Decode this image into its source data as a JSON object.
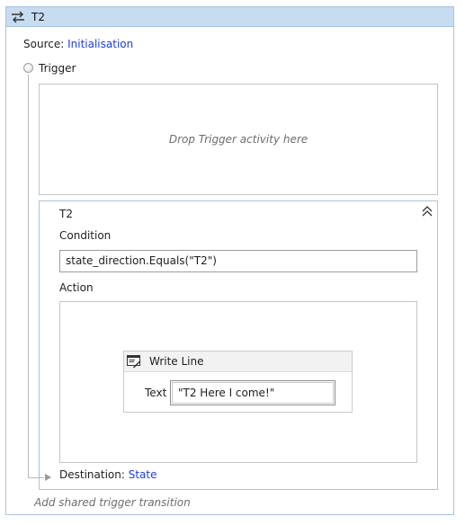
{
  "header": {
    "title": "T2",
    "icon": "transition-arrows-icon"
  },
  "source": {
    "label": "Source:",
    "value": "Initialisation"
  },
  "trigger": {
    "label": "Trigger",
    "drop_placeholder": "Drop Trigger activity here"
  },
  "transition": {
    "title": "T2",
    "condition_label": "Condition",
    "condition_value": "state_direction.Equals(\"T2\")",
    "action_label": "Action",
    "activity": {
      "title": "Write Line",
      "icon": "write-line-icon",
      "text_label": "Text",
      "text_value": "\"T2 Here I come!\""
    }
  },
  "destination": {
    "label": "Destination:",
    "value": "State"
  },
  "footer": {
    "add_shared": "Add shared trigger transition"
  },
  "colors": {
    "header_bg": "#c6dcf1",
    "frame_border": "#a8c3dc",
    "link": "#1b3ee0",
    "placeholder_text": "#6d6d6d"
  }
}
